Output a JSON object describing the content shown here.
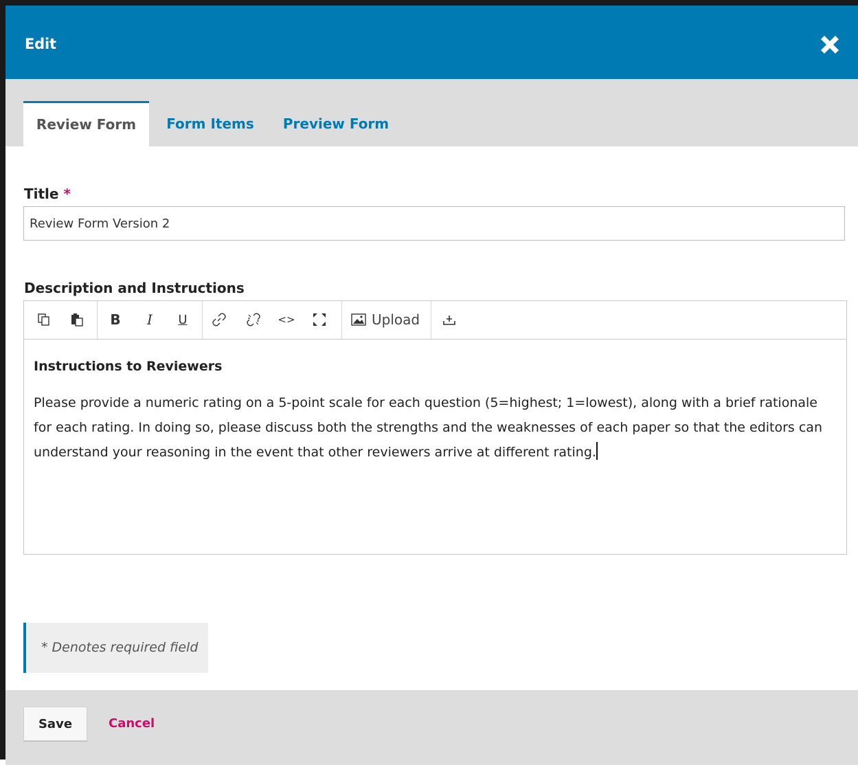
{
  "header": {
    "title": "Edit",
    "close_icon": "close-icon"
  },
  "tabs": [
    {
      "label": "Review Form",
      "active": true
    },
    {
      "label": "Form Items",
      "active": false
    },
    {
      "label": "Preview Form",
      "active": false
    }
  ],
  "form": {
    "title_label": "Title",
    "required_mark": "*",
    "title_value": "Review Form Version 2",
    "description_label": "Description and Instructions",
    "toolbar": {
      "buttons": [
        "copy-icon",
        "paste-icon",
        "bold-icon",
        "italic-icon",
        "underline-icon",
        "link-icon",
        "unlink-icon",
        "code-icon",
        "fullscreen-icon",
        "image-icon",
        "import-icon"
      ],
      "bold": "B",
      "italic": "I",
      "underline": "U",
      "code": "<>",
      "upload_label": "Upload"
    },
    "editor": {
      "heading": "Instructions to Reviewers",
      "body": "Please provide a numeric rating on a 5-point scale for each question (5=highest; 1=lowest), along with a brief rationale for each rating. In doing so, please discuss both the strengths and the weaknesses of each paper so that the editors can understand your reasoning in the event that other reviewers arrive at different rating."
    },
    "required_notice": "* Denotes required field"
  },
  "footer": {
    "save_label": "Save",
    "cancel_label": "Cancel"
  },
  "colors": {
    "primary": "#007ab2",
    "accent": "#d00a6c",
    "bar_gray": "#dddddd"
  }
}
